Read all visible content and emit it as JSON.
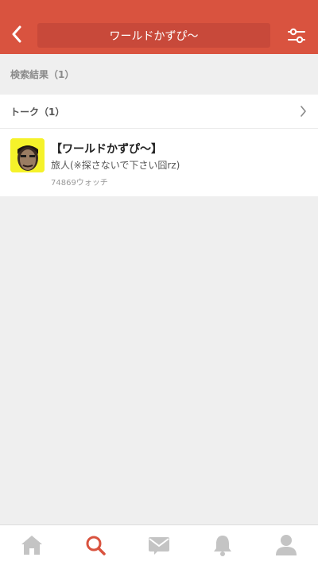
{
  "header": {
    "search_query": "ワールドかずぴ〜",
    "back_icon": "chevron-left-icon",
    "filter_icon": "sliders-icon"
  },
  "results": {
    "summary": "検索結果（1）"
  },
  "talk_section": {
    "title": "トーク（1）",
    "chevron_icon": "chevron-right-icon",
    "items": [
      {
        "title": "【ワールドかずぴ〜】",
        "subtitle": "旅人(※探さないで下さい囧rz)",
        "watch_count": "74869ウォッチ"
      }
    ]
  },
  "tabbar": {
    "tabs": [
      {
        "icon": "home-icon",
        "active": false
      },
      {
        "icon": "search-icon",
        "active": true
      },
      {
        "icon": "mail-icon",
        "active": false
      },
      {
        "icon": "bell-icon",
        "active": false
      },
      {
        "icon": "user-icon",
        "active": false
      }
    ]
  },
  "colors": {
    "header_bg": "#d9533f",
    "search_box_bg": "#c8493a",
    "active_tab": "#d9533f",
    "inactive_tab": "#c4c4c4",
    "avatar_bg": "#f5f22a"
  }
}
